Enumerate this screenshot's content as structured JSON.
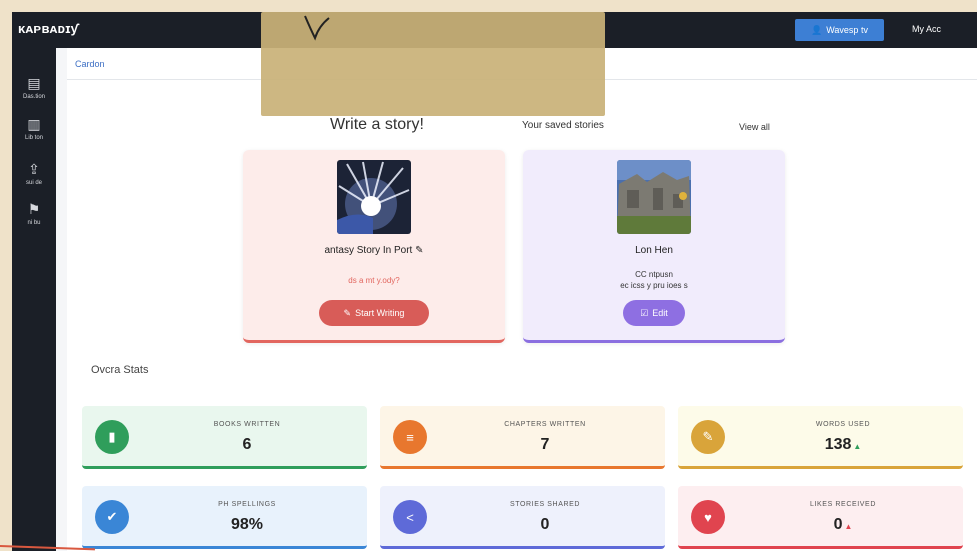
{
  "app": {
    "brand": "ᴋᴀᴘʙᴀᴅɪƴ",
    "top_button": "Wavesp tv",
    "top_link": "My Acc"
  },
  "sidebar": [
    {
      "icon": "file-icon",
      "glyph": "▤",
      "label": "Das.tion"
    },
    {
      "icon": "book-icon",
      "glyph": "▥",
      "label": "Lib ton"
    },
    {
      "icon": "upload-icon",
      "glyph": "⇪",
      "label": "sui de"
    },
    {
      "icon": "flag-icon",
      "glyph": "⚑",
      "label": "ni bu"
    }
  ],
  "breadcrumb": "Cardon",
  "write": {
    "heading": "Write a story!"
  },
  "saved": {
    "heading": "Your saved stories",
    "view_all": "View all"
  },
  "new_story_card": {
    "title": "antasy Story In Port",
    "link": "ds a mt y.ody?",
    "button": "Start Writing"
  },
  "saved_story_card": {
    "title": "Lon Hen",
    "line1": "CC ntpusn",
    "line2": "ec icss y pru ioes s",
    "button": "Edit"
  },
  "overall_stats": {
    "heading": "Ovcra Stats",
    "items": [
      {
        "label": "BOOKS WRITTEN",
        "value": "6",
        "color": "#2f9e5b",
        "icon": "book-icon",
        "glyph": "▮",
        "bg": "#e9f7ee",
        "trend": ""
      },
      {
        "label": "CHAPTERS WRITTEN",
        "value": "7",
        "color": "#e8772e",
        "icon": "chapter-icon",
        "glyph": "≡",
        "bg": "#fdf5e7",
        "trend": ""
      },
      {
        "label": "WORDS USED",
        "value": "138",
        "color": "#d9a43a",
        "icon": "pencil-icon",
        "glyph": "✎",
        "bg": "#fdfbe9",
        "trend": "▲"
      },
      {
        "label": "PH SPELLINGS",
        "value": "98%",
        "color": "#3a86d6",
        "icon": "check-icon",
        "glyph": "✔",
        "bg": "#e8f2fc",
        "trend": ""
      },
      {
        "label": "STORIES SHARED",
        "value": "0",
        "color": "#5e6ad8",
        "icon": "share-icon",
        "glyph": "<",
        "bg": "#eef1fc",
        "trend": ""
      },
      {
        "label": "LIKES RECEIVED",
        "value": "0",
        "color": "#e0444f",
        "icon": "thumb-icon",
        "glyph": "♥",
        "bg": "#fdeef0",
        "trend": "▲"
      }
    ]
  }
}
